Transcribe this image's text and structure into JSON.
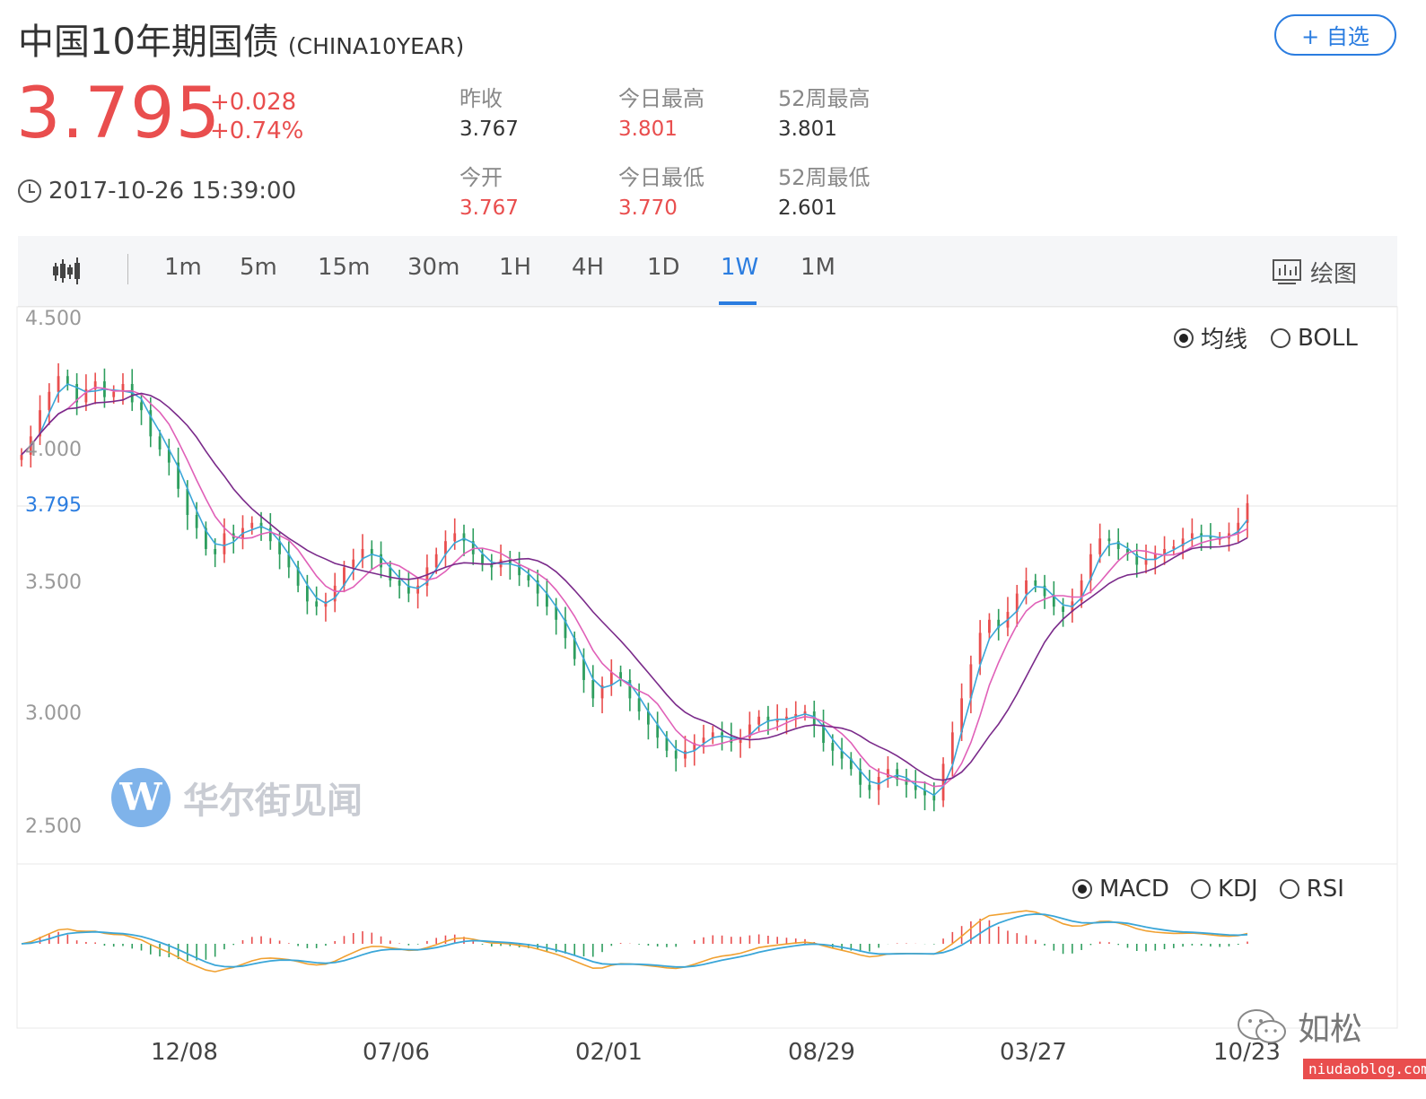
{
  "header": {
    "name": "中国10年期国债",
    "code": "(CHINA10YEAR)",
    "add_button": "+ 自选",
    "price": "3.795",
    "change": "+0.028",
    "change_pct": "+0.74%",
    "timestamp": "2017-10-26 15:39:00"
  },
  "stats": [
    {
      "label": "昨收",
      "value": "3.767",
      "color": "#333333"
    },
    {
      "label": "今日最高",
      "value": "3.801",
      "color": "#e94e4e"
    },
    {
      "label": "52周最高",
      "value": "3.801",
      "color": "#333333"
    },
    {
      "label": "今开",
      "value": "3.767",
      "color": "#e94e4e"
    },
    {
      "label": "今日最低",
      "value": "3.770",
      "color": "#e94e4e"
    },
    {
      "label": "52周最低",
      "value": "2.601",
      "color": "#333333"
    }
  ],
  "toolbar": {
    "periods": [
      "1m",
      "5m",
      "15m",
      "30m",
      "1H",
      "4H",
      "1D",
      "1W",
      "1M"
    ],
    "active_period": "1W",
    "draw_label": "绘图"
  },
  "overlay_options": {
    "ma": "均线",
    "boll": "BOLL",
    "selected": "均线"
  },
  "indicator_options": {
    "macd": "MACD",
    "kdj": "KDJ",
    "rsi": "RSI",
    "selected": "MACD"
  },
  "watermark": {
    "text": "华尔街见闻",
    "logo": "W"
  },
  "footer": {
    "wechat_name": "如松",
    "blog": "niudaoblog.com"
  },
  "colors": {
    "up": "#e94e4e",
    "down": "#2e9e5e",
    "accent": "#2b7de0",
    "ma_fast": "#3aa6d8",
    "ma_mid": "#e060b8",
    "ma_slow": "#7a2a8a",
    "dif": "#3aa6d8",
    "dea": "#f0a030"
  },
  "chart_data": {
    "type": "candlestick",
    "interval": "1W",
    "x_tick_labels": [
      "12/08",
      "07/06",
      "02/01",
      "08/29",
      "03/27",
      "10/23"
    ],
    "y_tick_labels": [
      "4.500",
      "4.000",
      "3.500",
      "3.000",
      "2.500"
    ],
    "ylim": [
      2.45,
      4.5
    ],
    "current_price_line": 3.795,
    "close_series": [
      3.98,
      4.05,
      4.15,
      4.22,
      4.28,
      4.25,
      4.18,
      4.23,
      4.26,
      4.2,
      4.22,
      4.25,
      4.18,
      4.15,
      4.05,
      4.0,
      3.95,
      3.85,
      3.75,
      3.7,
      3.62,
      3.6,
      3.68,
      3.66,
      3.7,
      3.72,
      3.7,
      3.65,
      3.6,
      3.55,
      3.48,
      3.42,
      3.4,
      3.42,
      3.48,
      3.55,
      3.58,
      3.62,
      3.6,
      3.55,
      3.5,
      3.48,
      3.45,
      3.48,
      3.55,
      3.6,
      3.65,
      3.68,
      3.65,
      3.6,
      3.56,
      3.55,
      3.58,
      3.56,
      3.52,
      3.5,
      3.45,
      3.4,
      3.35,
      3.28,
      3.2,
      3.12,
      3.05,
      3.1,
      3.15,
      3.12,
      3.05,
      3.0,
      2.95,
      2.9,
      2.85,
      2.82,
      2.85,
      2.88,
      2.9,
      2.92,
      2.9,
      2.88,
      2.9,
      2.95,
      2.98,
      2.96,
      2.97,
      2.98,
      2.99,
      3.0,
      2.95,
      2.88,
      2.85,
      2.82,
      2.78,
      2.72,
      2.7,
      2.75,
      2.78,
      2.74,
      2.72,
      2.7,
      2.68,
      2.66,
      2.8,
      2.92,
      3.05,
      3.18,
      3.3,
      3.35,
      3.32,
      3.38,
      3.45,
      3.5,
      3.48,
      3.44,
      3.4,
      3.38,
      3.42,
      3.5,
      3.6,
      3.66,
      3.65,
      3.62,
      3.6,
      3.56,
      3.58,
      3.6,
      3.62,
      3.63,
      3.66,
      3.68,
      3.67,
      3.66,
      3.66,
      3.68,
      3.72,
      3.795
    ]
  }
}
